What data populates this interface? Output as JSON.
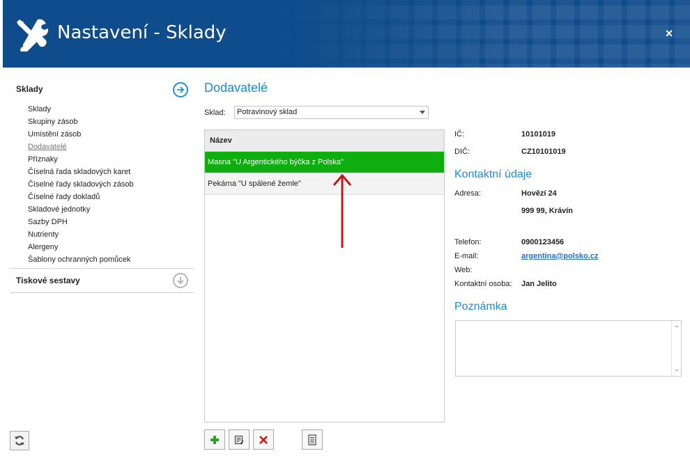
{
  "header": {
    "title": "Nastavení - Sklady",
    "close_label": "×"
  },
  "sidebar": {
    "section1": {
      "label": "Sklady"
    },
    "items": [
      {
        "label": "Sklady",
        "active": false
      },
      {
        "label": "Skupiny zásob",
        "active": false
      },
      {
        "label": "Umístění zásob",
        "active": false
      },
      {
        "label": "Dodavatelé",
        "active": true
      },
      {
        "label": "Příznaky",
        "active": false
      },
      {
        "label": "Číselná řada skladových karet",
        "active": false
      },
      {
        "label": "Číselné řady skladových zásob",
        "active": false
      },
      {
        "label": "Číselné řady dokladů",
        "active": false
      },
      {
        "label": "Skladové jednotky",
        "active": false
      },
      {
        "label": "Sazby DPH",
        "active": false
      },
      {
        "label": "Nutrienty",
        "active": false
      },
      {
        "label": "Alergeny",
        "active": false
      },
      {
        "label": "Šablony ochranných pomůcek",
        "active": false
      }
    ],
    "section2": {
      "label": "Tiskové sestavy"
    }
  },
  "main": {
    "title": "Dodavatelé",
    "sklad_label": "Sklad:",
    "sklad_value": "Potravinový sklad",
    "grid": {
      "header": "Název",
      "rows": [
        {
          "name": "Masna \"U Argentického býčka z Polska\"",
          "selected": true
        },
        {
          "name": "Pekárna \"U spálené žemle\"",
          "selected": false
        }
      ]
    }
  },
  "detail": {
    "ic": {
      "label": "IČ:",
      "value": "10101019"
    },
    "dic": {
      "label": "DIČ:",
      "value": "CZ10101019"
    },
    "contact_title": "Kontaktní údaje",
    "address": {
      "label": "Adresa:",
      "line1": "Hovězí 24",
      "line2": "999 99, Krávín"
    },
    "phone": {
      "label": "Telefon:",
      "value": "0900123456"
    },
    "email": {
      "label": "E-mail:",
      "value": "argentina@polsko.cz"
    },
    "web": {
      "label": "Web:",
      "value": ""
    },
    "contact_person": {
      "label": "Kontaktní osoba:",
      "value": "Jan Jelito"
    },
    "note_title": "Poznámka",
    "note_value": ""
  },
  "colors": {
    "header_bg": "#0f4c8c",
    "accent": "#1e8ad2",
    "selected_row": "#0fae0f",
    "add_icon": "#2ea02e",
    "delete_icon": "#e01010",
    "annotation_arrow": "#c4161c"
  },
  "icons": {
    "title": "wrench-screwdriver-icon",
    "section1_toggle": "arrow-right-circle-icon",
    "section2_toggle": "arrow-down-circle-icon",
    "refresh": "refresh-icon",
    "add": "plus-icon",
    "edit": "edit-icon",
    "delete": "delete-icon",
    "document": "document-icon"
  }
}
